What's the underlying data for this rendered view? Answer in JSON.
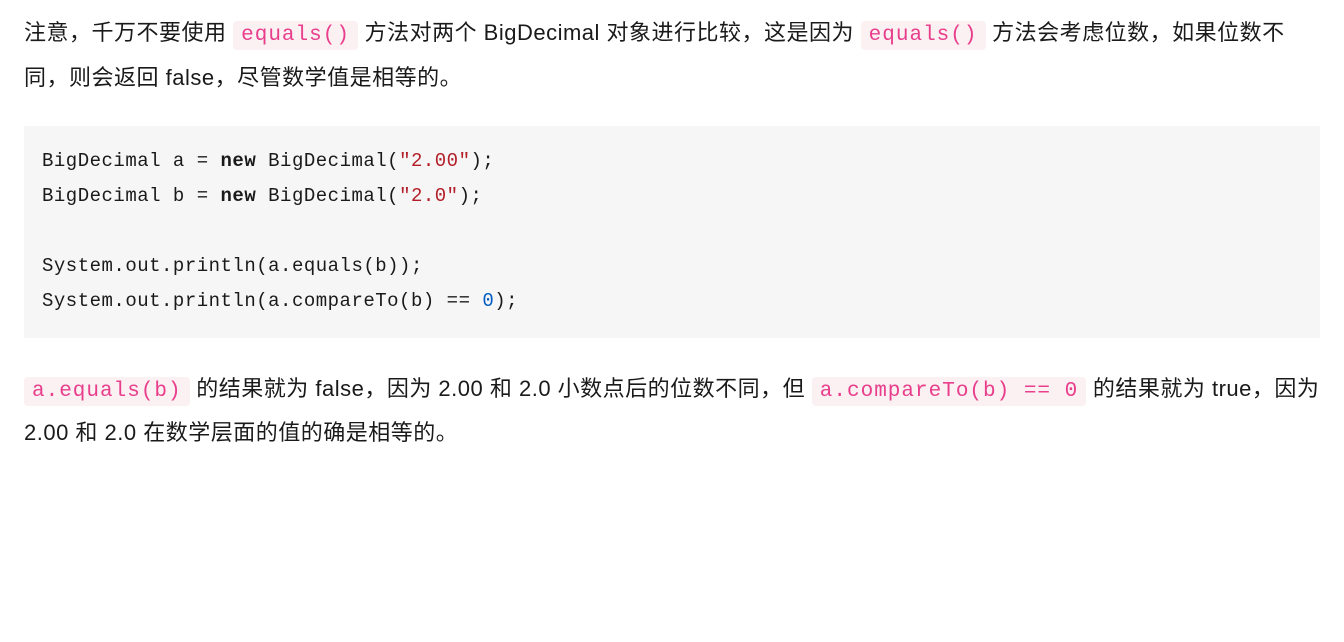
{
  "para1": {
    "t1": "注意，千万不要使用 ",
    "c1": "equals()",
    "t2": " 方法对两个 BigDecimal 对象进行比较，这是因为 ",
    "c2": "equals()",
    "t3": " 方法会考虑位数，如果位数不同，则会返回 false，尽管数学值是相等的。"
  },
  "code": {
    "l1a": "BigDecimal a = ",
    "l1kw": "new",
    "l1b": " BigDecimal(",
    "l1str": "\"2.00\"",
    "l1c": ");",
    "l2a": "BigDecimal b = ",
    "l2kw": "new",
    "l2b": " BigDecimal(",
    "l2str": "\"2.0\"",
    "l2c": ");",
    "blank": "",
    "l3": "System.out.println(a.equals(b));",
    "l4a": "System.out.println(a.compareTo(b) == ",
    "l4num": "0",
    "l4b": ");"
  },
  "para2": {
    "c1": "a.equals(b)",
    "t1": " 的结果就为 false，因为 2.00 和 2.0 小数点后的位数不同，但 ",
    "c2": "a.compareTo(b) == 0",
    "t2": " 的结果就为 true，因为 2.00 和 2.0 在数学层面的值的确是相等的。"
  }
}
